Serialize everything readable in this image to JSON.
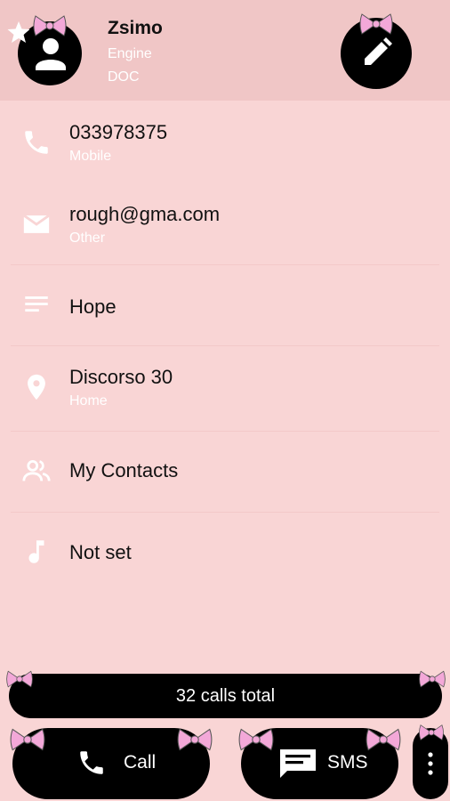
{
  "contact": {
    "name": "Zsimo",
    "company": "Engine",
    "title": "DOC"
  },
  "rows": [
    {
      "icon": "phone-icon",
      "text": "033978375",
      "sub": "Mobile"
    },
    {
      "icon": "email-icon",
      "text": "rough@gma.com",
      "sub": "Other"
    },
    {
      "icon": "notes-icon",
      "text": "Hope"
    },
    {
      "icon": "location-icon",
      "text": "Discorso 30",
      "sub": "Home"
    },
    {
      "icon": "group-icon",
      "text": "My Contacts"
    },
    {
      "icon": "ringtone-icon",
      "text": "Not set"
    }
  ],
  "calls_total": "32 calls total",
  "actions": {
    "call_label": "Call",
    "sms_label": "SMS"
  },
  "colors": {
    "background": "#f9d5d5",
    "header": "#f0c6c6",
    "accent": "#000000",
    "bow": "#f3a8d8"
  }
}
